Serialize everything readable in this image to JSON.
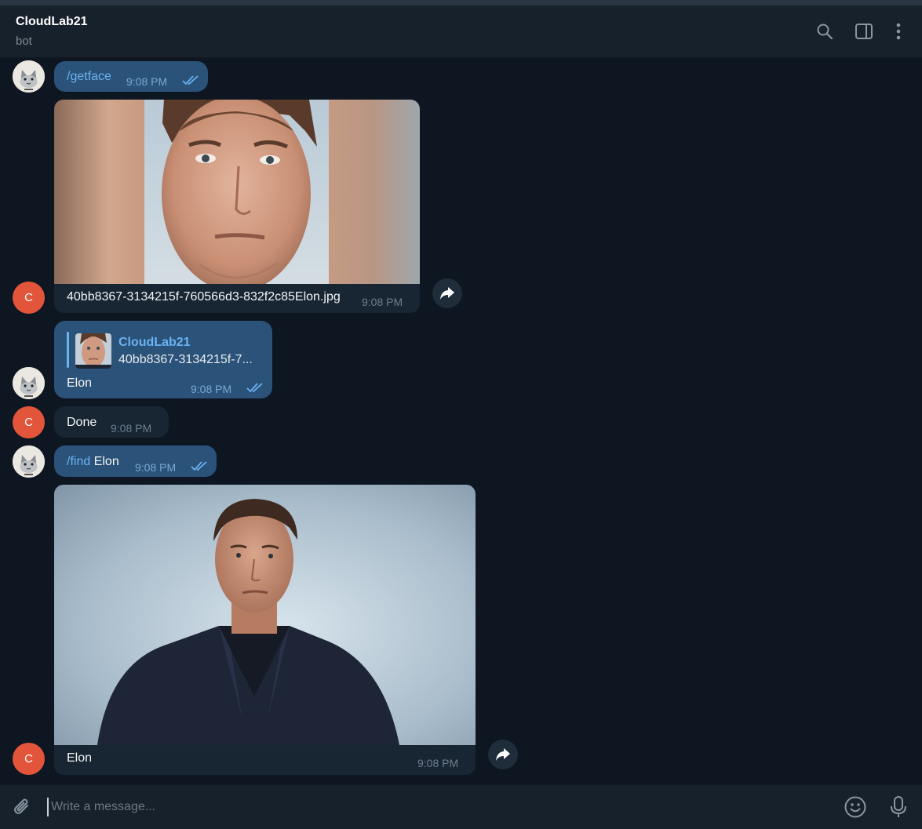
{
  "header": {
    "title": "CloudLab21",
    "subtitle": "bot",
    "icons": [
      "search-icon",
      "sidebar-toggle-icon",
      "more-vertical-icon"
    ]
  },
  "avatars": {
    "bot_initial": "C"
  },
  "messages": [
    {
      "id": "m1",
      "direction": "out",
      "command": "/getface",
      "text": "",
      "time": "9:08 PM",
      "status": "read"
    },
    {
      "id": "m2",
      "direction": "in",
      "type": "photo",
      "caption": "40bb8367-3134215f-760566d3-832f2c85Elon.jpg",
      "time": "9:08 PM"
    },
    {
      "id": "m3",
      "direction": "out",
      "reply_to": {
        "author": "CloudLab21",
        "preview": "40bb8367-3134215f-7..."
      },
      "text": "Elon",
      "time": "9:08 PM",
      "status": "read"
    },
    {
      "id": "m4",
      "direction": "in",
      "text": "Done",
      "time": "9:08 PM"
    },
    {
      "id": "m5",
      "direction": "out",
      "command": "/find",
      "text": " Elon",
      "time": "9:08 PM",
      "status": "read"
    },
    {
      "id": "m6",
      "direction": "in",
      "type": "photo",
      "caption": "Elon",
      "time": "9:08 PM"
    }
  ],
  "composer": {
    "placeholder": "Write a message...",
    "icons": [
      "attach-icon",
      "emoji-icon",
      "microphone-icon"
    ]
  },
  "colors": {
    "background": "#0e1621",
    "header": "#17212b",
    "outgoing_bubble": "#2b5278",
    "incoming_bubble": "#182533",
    "accent": "#6ab3f3",
    "bot_avatar": "#e2553a"
  }
}
